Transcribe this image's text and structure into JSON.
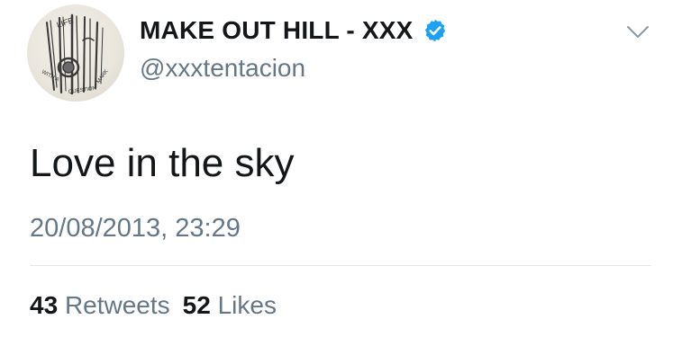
{
  "user": {
    "display_name": "MAKE OUT HILL - XXX",
    "handle": "@xxxtentacion",
    "verified": true,
    "verified_color": "#1da1f2",
    "avatar_text": [
      "LIFE",
      "WITH A QUESTION MARK"
    ]
  },
  "tweet": {
    "text": "Love in the sky",
    "timestamp": "20/08/2013, 23:29"
  },
  "stats": {
    "retweets_count": "43",
    "retweets_label": "Retweets",
    "likes_count": "52",
    "likes_label": "Likes"
  },
  "icons": {
    "menu": "chevron-down-icon",
    "verified": "verified-badge-icon"
  },
  "colors": {
    "text_primary": "#14171a",
    "text_secondary": "#657786",
    "divider": "#e1e8ed"
  }
}
